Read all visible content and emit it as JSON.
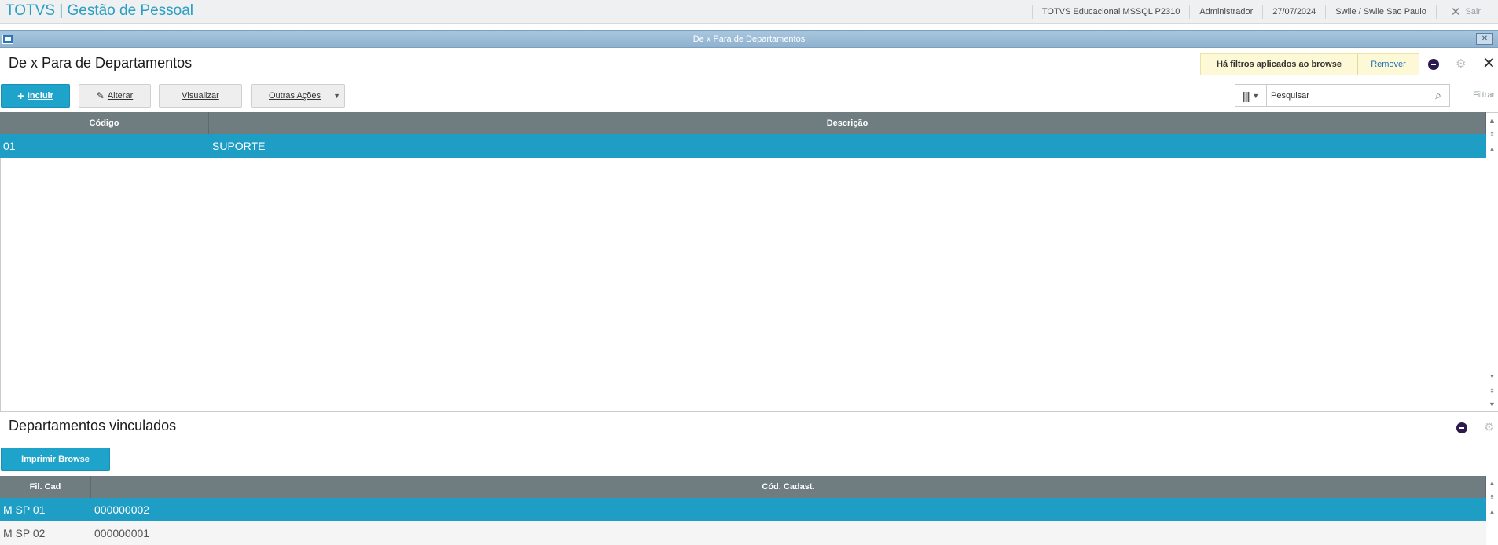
{
  "app": {
    "title": "TOTVS | Gestão de Pessoal",
    "environment": "TOTVS Educacional MSSQL P2310",
    "user": "Administrador",
    "date": "27/07/2024",
    "branch": "Swile / Swile Sao Paulo",
    "exit_label": "Sair"
  },
  "window": {
    "title": "De x Para de Departamentos"
  },
  "main": {
    "title": "De x Para de Departamentos",
    "filter_notice": "Há filtros aplicados ao browse",
    "filter_remove": "Remover",
    "buttons": {
      "incluir": "Incluir",
      "alterar": "Alterar",
      "visualizar": "Visualizar",
      "outras": "Outras Ações"
    },
    "search_placeholder": "Pesquisar",
    "filtrar_label": "Filtrar",
    "columns": [
      "Código",
      "Descrição"
    ],
    "rows": [
      {
        "codigo": "01",
        "descricao": "SUPORTE"
      }
    ]
  },
  "detail": {
    "title": "Departamentos vinculados",
    "print_button": "Imprimir Browse",
    "columns": [
      "Fil. Cad",
      "Cód. Cadast."
    ],
    "rows": [
      {
        "fil": "M SP 01",
        "cod": "000000002"
      },
      {
        "fil": "M SP 02",
        "cod": "000000001"
      }
    ]
  },
  "icons": {
    "close": "close-icon",
    "gear": "gear-icon",
    "search": "search-icon",
    "columns": "columns-icon",
    "pencil": "pencil-icon",
    "plus": "plus-icon"
  },
  "colors": {
    "brand": "#2b9ec2",
    "primary_button": "#1ea3cb",
    "grid_header": "#6f7c80",
    "selected_row": "#1e9ec4"
  }
}
